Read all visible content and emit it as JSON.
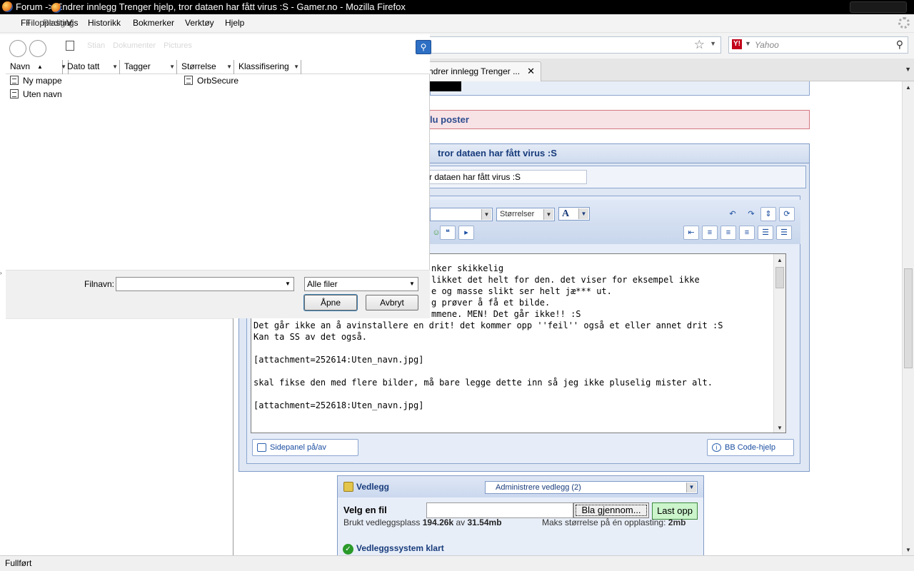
{
  "window": {
    "title": "Forum -> Endrer innlegg Trenger hjelp, tror dataen har fått virus :S - Gamer.no - Mozilla Firefox"
  },
  "menubar": {
    "items": [
      "Fil",
      "Rediger",
      "Vis",
      "Historikk",
      "Bokmerker",
      "Verktøy",
      "Hjelp"
    ],
    "overlay_text": "Filopplasting"
  },
  "navbar": {
    "search_placeholder": "Yahoo",
    "search_engine_icon": "Y!"
  },
  "tabs": [
    {
      "label": "ndrer innlegg Trenger ...",
      "active": true
    }
  ],
  "page": {
    "notice": "lu poster",
    "post_header": "tror dataen har fått virus :S",
    "title_value": "r dataen har fått virus :S",
    "editor": {
      "font_select": "",
      "size_select": "Størrelser",
      "color_select": "A"
    },
    "message_lines": [
      "nker skikkelig",
      "likket det helt for den. det viser for eksempel ikke",
      "e og masse slikt ser helt jæ*** ut.",
      "g prøver å få et bilde.",
      "mmene. MEN! Det går ikke!! :S",
      "Det går ikke an å avinstallere en drit! det kommer opp ''feil'' også et eller annet drit :S",
      "Kan ta SS av det også.",
      "",
      "[attachment=252614:Uten_navn.jpg]",
      "",
      "skal fikse den med flere bilder, må bare legge dette inn så jeg ikke pluselig mister alt.",
      "",
      "[attachment=252618:Uten_navn.jpg]"
    ],
    "sidepanel_label": "Sidepanel på/av",
    "bbcode_label": "BB Code-hjelp",
    "attachments": {
      "title": "Vedlegg",
      "manage_select": "Administrere vedlegg (2)",
      "choose_label": "Velg en fil",
      "browse_label": "Bla gjennom...",
      "upload_label": "Last opp",
      "used_prefix": "Brukt vedleggsplass",
      "used_value": "194.26k",
      "used_of": "av",
      "used_total": "31.54mb",
      "max_label": "Maks størrelse på én opplasting:",
      "max_value": "2mb",
      "ready_label": "Vedleggssystem klart"
    }
  },
  "statusbar": {
    "text": "Fullført"
  },
  "file_dialog": {
    "breadcrumbs": [
      "Stian",
      "Dokumenter",
      "Pictures"
    ],
    "columns": [
      "Navn",
      "Dato tatt",
      "Tagger",
      "Størrelse",
      "Klassifisering"
    ],
    "items": [
      "Ny mappe",
      "Uten navn",
      "OrbSecure"
    ],
    "filename_label": "Filnavn:",
    "filename_value": "",
    "filter": "Alle filer",
    "open_label": "Åpne",
    "cancel_label": "Avbryt"
  }
}
